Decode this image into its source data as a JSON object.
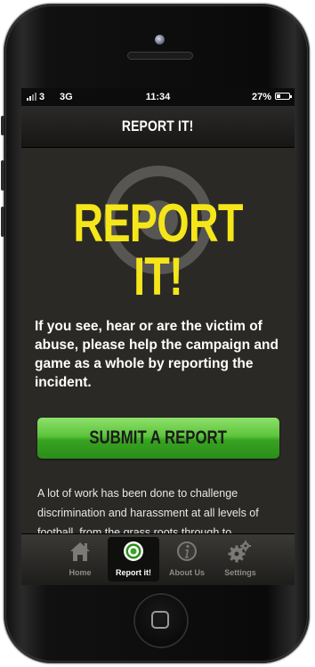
{
  "status_bar": {
    "carrier": "3",
    "network": "3G",
    "time": "11:34",
    "battery": "27%",
    "battery_level": 0.27
  },
  "nav": {
    "title": "REPORT IT!"
  },
  "hero": {
    "title": "REPORT IT!"
  },
  "intro_text": "If you see, hear or are the victim of abuse, please help the campaign and game as a whole by reporting the incident.",
  "submit_button": {
    "label": "SUBMIT A REPORT"
  },
  "body_text": "A lot of work has been done to challenge discrimination and harassment at all levels of football, from the grass roots through to",
  "tab_bar": {
    "tabs": [
      {
        "label": "Home",
        "icon": "home-icon",
        "active": false
      },
      {
        "label": "Report it!",
        "icon": "target-icon",
        "active": true
      },
      {
        "label": "About Us",
        "icon": "info-icon",
        "active": false
      },
      {
        "label": "Settings",
        "icon": "gear-icon",
        "active": false
      }
    ]
  },
  "colors": {
    "accent_yellow": "#f5e61a",
    "button_green": "#4cb82e",
    "background": "#2b2926"
  }
}
